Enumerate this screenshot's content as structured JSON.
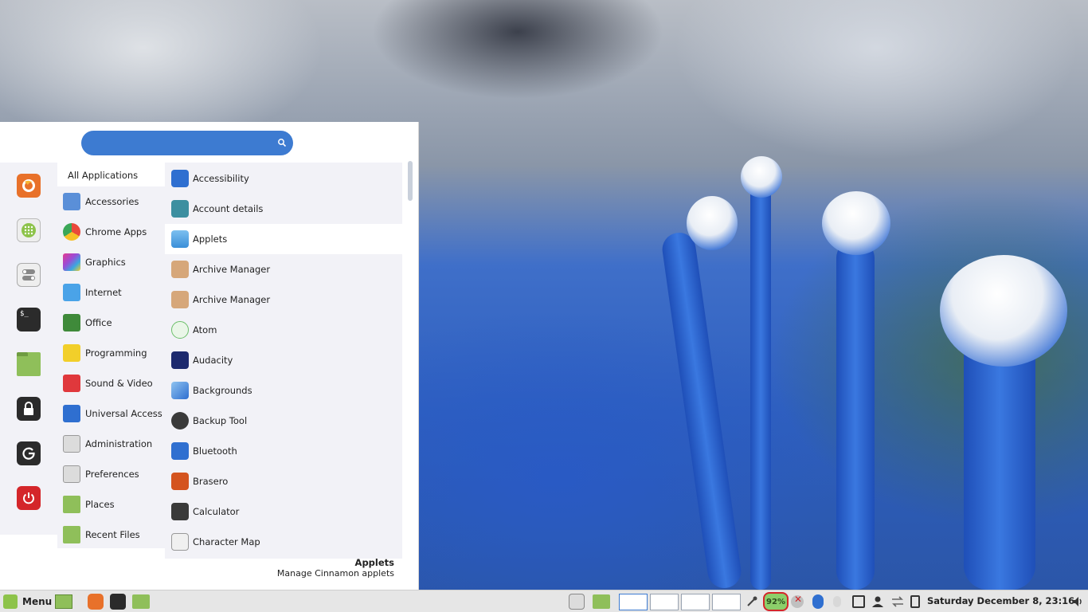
{
  "search": {
    "placeholder": "",
    "value": ""
  },
  "favorites": [
    {
      "name": "firefox-icon",
      "color": "#e8712a"
    },
    {
      "name": "app-grid-icon",
      "color": "#8dc34a"
    },
    {
      "name": "settings-toggle-icon",
      "color": "#dcdcdc"
    },
    {
      "name": "terminal-icon",
      "color": "#2b2b2b"
    },
    {
      "name": "folder-icon",
      "color": "#8fbf5a"
    },
    {
      "name": "lock-screen-icon",
      "color": "#2b2b2b"
    },
    {
      "name": "logout-icon",
      "color": "#2b2b2b"
    },
    {
      "name": "power-icon",
      "color": "#d4262a"
    }
  ],
  "categories": {
    "header": "All Applications",
    "items": [
      {
        "label": "Accessories",
        "icon": "scissors-icon",
        "color": "#5a8fd8"
      },
      {
        "label": "Chrome Apps",
        "icon": "chrome-icon",
        "color": "#e9493b"
      },
      {
        "label": "Graphics",
        "icon": "graphics-icon",
        "color": "#9b4bd6"
      },
      {
        "label": "Internet",
        "icon": "cloud-icon",
        "color": "#4aa3e8"
      },
      {
        "label": "Office",
        "icon": "office-icon",
        "color": "#3f8a3a"
      },
      {
        "label": "Programming",
        "icon": "programming-icon",
        "color": "#f2cf2a"
      },
      {
        "label": "Sound & Video",
        "icon": "play-icon",
        "color": "#e0383c"
      },
      {
        "label": "Universal Access",
        "icon": "accessibility-icon",
        "color": "#2f6fd0"
      },
      {
        "label": "Administration",
        "icon": "admin-icon",
        "color": "#d8d8d8"
      },
      {
        "label": "Preferences",
        "icon": "preferences-icon",
        "color": "#d8d8d8"
      },
      {
        "label": "Places",
        "icon": "folder-icon",
        "color": "#8fbf5a"
      },
      {
        "label": "Recent Files",
        "icon": "recent-files-icon",
        "color": "#8fbf5a"
      }
    ]
  },
  "apps": [
    {
      "label": "Accessibility",
      "icon": "accessibility-icon",
      "color": "#2f6fd0"
    },
    {
      "label": "Account details",
      "icon": "account-icon",
      "color": "#3d8fa0"
    },
    {
      "label": "Applets",
      "icon": "applets-icon",
      "color": "#5aa5e0"
    },
    {
      "label": "Archive Manager",
      "icon": "archive-icon",
      "color": "#d6a77a"
    },
    {
      "label": "Archive Manager",
      "icon": "archive-icon",
      "color": "#d6a77a"
    },
    {
      "label": "Atom",
      "icon": "atom-icon",
      "color": "#6cbf6a"
    },
    {
      "label": "Audacity",
      "icon": "audacity-icon",
      "color": "#1d2a6e"
    },
    {
      "label": "Backgrounds",
      "icon": "backgrounds-icon",
      "color": "#4a8fd8"
    },
    {
      "label": "Backup Tool",
      "icon": "backup-icon",
      "color": "#3a3a3a"
    },
    {
      "label": "Bluetooth",
      "icon": "bluetooth-icon",
      "color": "#2f6fd0"
    },
    {
      "label": "Brasero",
      "icon": "brasero-icon",
      "color": "#d4541f"
    },
    {
      "label": "Calculator",
      "icon": "calculator-icon",
      "color": "#3a3a3a"
    },
    {
      "label": "Character Map",
      "icon": "character-map-icon",
      "color": "#f0f0f0"
    }
  ],
  "description": {
    "title": "Applets",
    "text": "Manage Cinnamon applets"
  },
  "taskbar": {
    "menu_label": "Menu",
    "battery": "92%",
    "clock": "Saturday December  8, 23:16"
  },
  "colors": {
    "accent": "#3d7bd1",
    "panel_bg": "#e6e6e6",
    "list_bg": "#f2f2f7"
  }
}
